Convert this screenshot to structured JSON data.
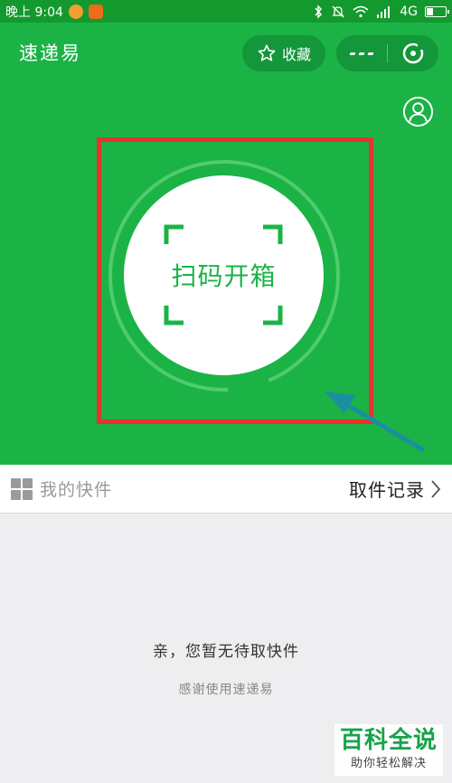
{
  "status_bar": {
    "time": "晚上 9:04",
    "network": "4G",
    "icons": [
      "chat-bubble-icon",
      "app-notify-icon",
      "bluetooth-icon",
      "mute-icon",
      "wifi-icon",
      "signal-icon",
      "battery-icon"
    ]
  },
  "header": {
    "title": "速递易",
    "favorite_label": "收藏",
    "favorite_icon": "star-icon",
    "more_icon": "more-icon",
    "close_icon": "close-target-icon"
  },
  "user_icon": "user-profile-icon",
  "scan": {
    "label": "扫码开箱"
  },
  "package_bar": {
    "label": "我的快件",
    "records_label": "取件记录",
    "icon": "grid-icon",
    "chevron_icon": "chevron-right-icon"
  },
  "empty_state": {
    "title": "亲，您暂无待取快件",
    "subtitle": "感谢使用速递易"
  },
  "watermark": {
    "main": "百科全说",
    "sub": "助你轻松解决"
  },
  "colors": {
    "primary_green": "#1bb346",
    "dark_green": "#14963a",
    "highlight_red": "#e8322e",
    "arrow_teal": "#1a8fa0"
  }
}
